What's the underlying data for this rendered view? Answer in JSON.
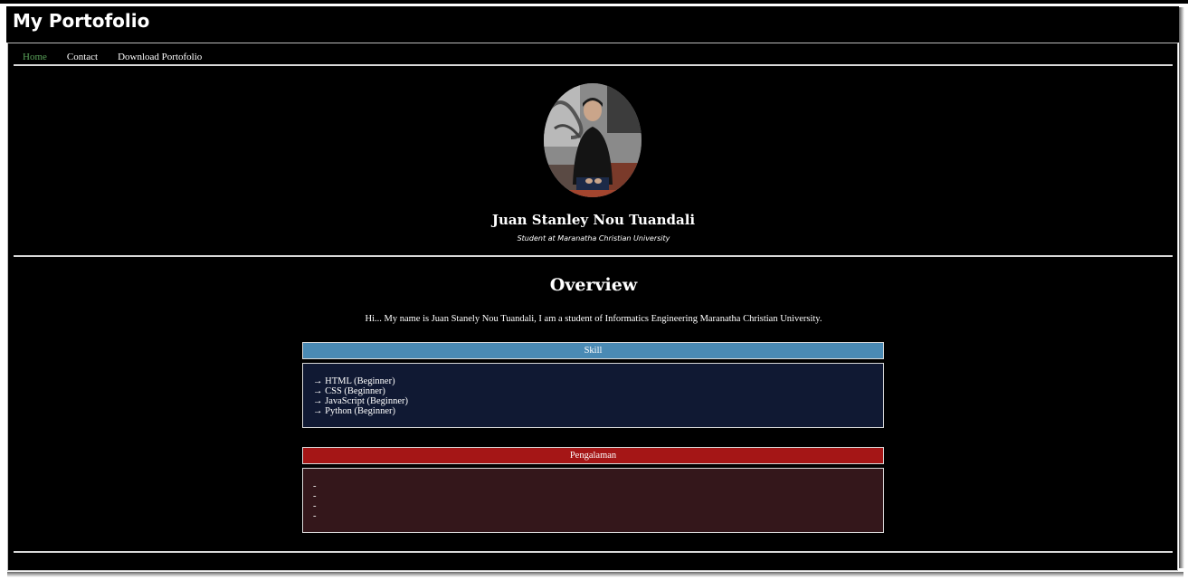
{
  "site": {
    "title": "My Portofolio"
  },
  "nav": {
    "items": [
      {
        "label": "Home",
        "active": true
      },
      {
        "label": "Contact",
        "active": false
      },
      {
        "label": "Download Portofolio",
        "active": false
      }
    ]
  },
  "profile": {
    "name": "Juan Stanley Nou Tuandali",
    "subtitle": "Student at Maranatha Christian University"
  },
  "overview": {
    "title": "Overview",
    "text": "Hi... My name is Juan Stanely Nou Tuandali, I am a student of Informatics Engineering Maranatha Christian University."
  },
  "skill": {
    "title": "Skill",
    "items": [
      "→ HTML (Beginner)",
      "→ CSS (Beginner)",
      "→ JavaScript (Beginner)",
      "→ Python (Beginner)"
    ]
  },
  "experience": {
    "title": "Pengalaman",
    "items": [
      "-",
      "-",
      "-",
      "-"
    ]
  },
  "colors": {
    "nav_active": "#5aa35a",
    "skill_header": "#4a8ab4",
    "skill_body": "#101933",
    "experience_header": "#a51616",
    "experience_body": "#34171b"
  }
}
